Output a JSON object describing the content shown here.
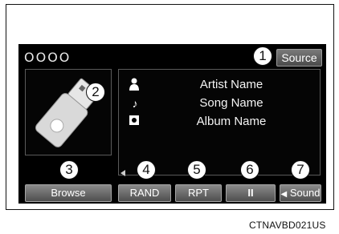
{
  "screen": {
    "indicator_text": "OOOO",
    "source_button": "Source"
  },
  "track_info": {
    "artist": "Artist Name",
    "song": "Song Name",
    "album": "Album Name",
    "icons": [
      "artist-icon",
      "music-note-icon",
      "album-icon"
    ]
  },
  "media_icon": "usb-drive-icon",
  "buttons": {
    "browse": "Browse",
    "rand": "RAND",
    "rpt": "RPT",
    "pause": "II",
    "sound": "Sound"
  },
  "callouts": [
    "1",
    "2",
    "3",
    "4",
    "5",
    "6",
    "7"
  ],
  "caption": "CTNAVBD021US",
  "colors": {
    "screen_bg": "#000000",
    "button_grad_top": "#8a8a8a",
    "button_grad_bottom": "#4e4e4e"
  }
}
